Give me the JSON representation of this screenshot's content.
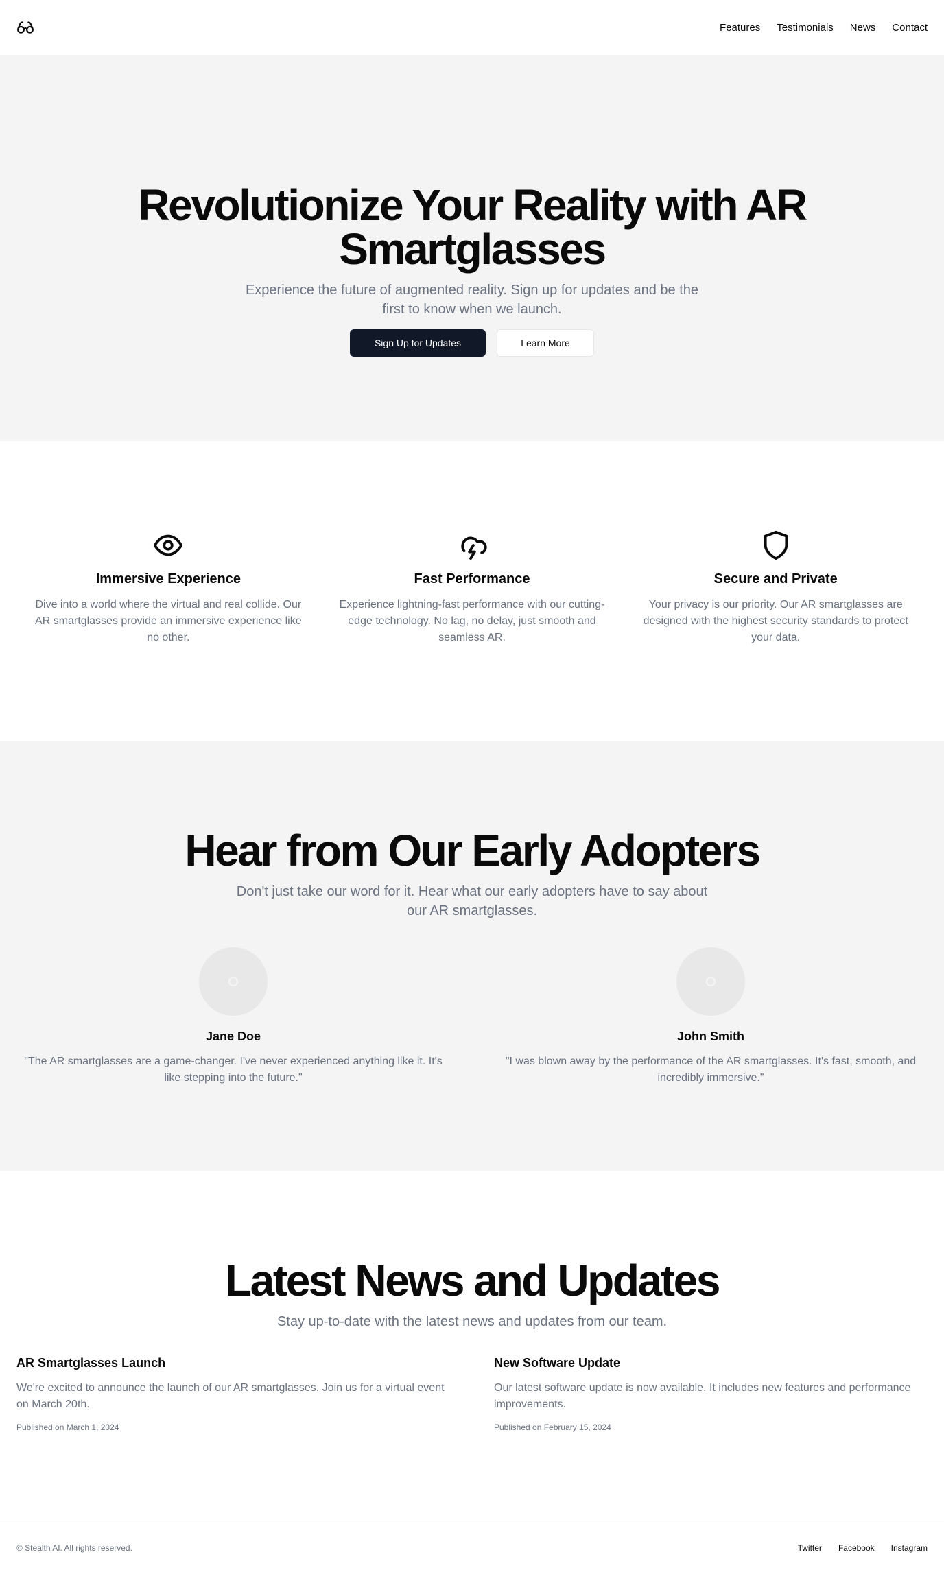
{
  "header": {
    "logo_icon": "glasses-icon",
    "nav": [
      {
        "label": "Features"
      },
      {
        "label": "Testimonials"
      },
      {
        "label": "News"
      },
      {
        "label": "Contact"
      }
    ]
  },
  "hero": {
    "title": "Revolutionize Your Reality with AR Smartglasses",
    "subtitle": "Experience the future of augmented reality. Sign up for updates and be the first to know when we launch.",
    "primary_button": "Sign Up for Updates",
    "secondary_button": "Learn More"
  },
  "features": [
    {
      "icon": "eye-icon",
      "title": "Immersive Experience",
      "description": "Dive into a world where the virtual and real collide. Our AR smartglasses provide an immersive experience like no other."
    },
    {
      "icon": "cloud-lightning-icon",
      "title": "Fast Performance",
      "description": "Experience lightning-fast performance with our cutting-edge technology. No lag, no delay, just smooth and seamless AR."
    },
    {
      "icon": "shield-icon",
      "title": "Secure and Private",
      "description": "Your privacy is our priority. Our AR smartglasses are designed with the highest security standards to protect your data."
    }
  ],
  "testimonials": {
    "title": "Hear from Our Early Adopters",
    "subtitle": "Don't just take our word for it. Hear what our early adopters have to say about our AR smartglasses.",
    "items": [
      {
        "name": "Jane Doe",
        "quote": "\"The AR smartglasses are a game-changer. I've never experienced anything like it. It's like stepping into the future.\""
      },
      {
        "name": "John Smith",
        "quote": "\"I was blown away by the performance of the AR smartglasses. It's fast, smooth, and incredibly immersive.\""
      }
    ]
  },
  "news": {
    "title": "Latest News and Updates",
    "subtitle": "Stay up-to-date with the latest news and updates from our team.",
    "items": [
      {
        "title": "AR Smartglasses Launch",
        "body": "We're excited to announce the launch of our AR smartglasses. Join us for a virtual event on March 20th.",
        "date": "Published on March 1, 2024"
      },
      {
        "title": "New Software Update",
        "body": "Our latest software update is now available. It includes new features and performance improvements.",
        "date": "Published on February 15, 2024"
      }
    ]
  },
  "footer": {
    "copyright": "© Stealth AI. All rights reserved.",
    "links": [
      {
        "label": "Twitter"
      },
      {
        "label": "Facebook"
      },
      {
        "label": "Instagram"
      }
    ]
  },
  "colors": {
    "primary_button_bg": "#111827",
    "section_alt_bg": "#f4f4f5",
    "muted_text": "#6b7280"
  }
}
